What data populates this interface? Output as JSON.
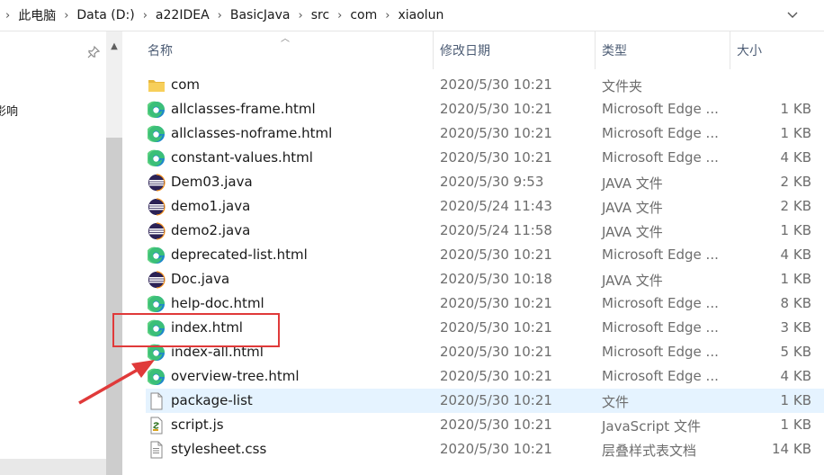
{
  "address": {
    "crumbs": [
      "此电脑",
      "Data (D:)",
      "a22IDEA",
      "BasicJava",
      "src",
      "com",
      "xiaolun"
    ]
  },
  "nav": {
    "partial_text": "影响"
  },
  "columns": {
    "name": "名称",
    "date": "修改日期",
    "type": "类型",
    "size": "大小"
  },
  "files": [
    {
      "name": "com",
      "date": "2020/5/30 10:21",
      "type": "文件夹",
      "size": "",
      "icon": "folder-icon"
    },
    {
      "name": "allclasses-frame.html",
      "date": "2020/5/30 10:21",
      "type": "Microsoft Edge ...",
      "size": "1 KB",
      "icon": "edge-icon"
    },
    {
      "name": "allclasses-noframe.html",
      "date": "2020/5/30 10:21",
      "type": "Microsoft Edge ...",
      "size": "1 KB",
      "icon": "edge-icon"
    },
    {
      "name": "constant-values.html",
      "date": "2020/5/30 10:21",
      "type": "Microsoft Edge ...",
      "size": "4 KB",
      "icon": "edge-icon"
    },
    {
      "name": "Dem03.java",
      "date": "2020/5/30 9:53",
      "type": "JAVA 文件",
      "size": "2 KB",
      "icon": "eclipse-java-icon"
    },
    {
      "name": "demo1.java",
      "date": "2020/5/24 11:43",
      "type": "JAVA 文件",
      "size": "2 KB",
      "icon": "eclipse-java-icon"
    },
    {
      "name": "demo2.java",
      "date": "2020/5/24 11:58",
      "type": "JAVA 文件",
      "size": "1 KB",
      "icon": "eclipse-java-icon"
    },
    {
      "name": "deprecated-list.html",
      "date": "2020/5/30 10:21",
      "type": "Microsoft Edge ...",
      "size": "4 KB",
      "icon": "edge-icon"
    },
    {
      "name": "Doc.java",
      "date": "2020/5/30 10:18",
      "type": "JAVA 文件",
      "size": "1 KB",
      "icon": "eclipse-java-icon"
    },
    {
      "name": "help-doc.html",
      "date": "2020/5/30 10:21",
      "type": "Microsoft Edge ...",
      "size": "8 KB",
      "icon": "edge-icon"
    },
    {
      "name": "index.html",
      "date": "2020/5/30 10:21",
      "type": "Microsoft Edge ...",
      "size": "3 KB",
      "icon": "edge-icon"
    },
    {
      "name": "index-all.html",
      "date": "2020/5/30 10:21",
      "type": "Microsoft Edge ...",
      "size": "5 KB",
      "icon": "edge-icon"
    },
    {
      "name": "overview-tree.html",
      "date": "2020/5/30 10:21",
      "type": "Microsoft Edge ...",
      "size": "4 KB",
      "icon": "edge-icon"
    },
    {
      "name": "package-list",
      "date": "2020/5/30 10:21",
      "type": "文件",
      "size": "1 KB",
      "icon": "blank-file-icon",
      "selected": true
    },
    {
      "name": "script.js",
      "date": "2020/5/30 10:21",
      "type": "JavaScript 文件",
      "size": "1 KB",
      "icon": "script-file-icon"
    },
    {
      "name": "stylesheet.css",
      "date": "2020/5/30 10:21",
      "type": "层叠样式表文档",
      "size": "14 KB",
      "icon": "css-file-icon"
    }
  ],
  "colors": {
    "selection": "#e5f3ff",
    "annotation": "#e03a3a",
    "header_text": "#4d5d75"
  }
}
